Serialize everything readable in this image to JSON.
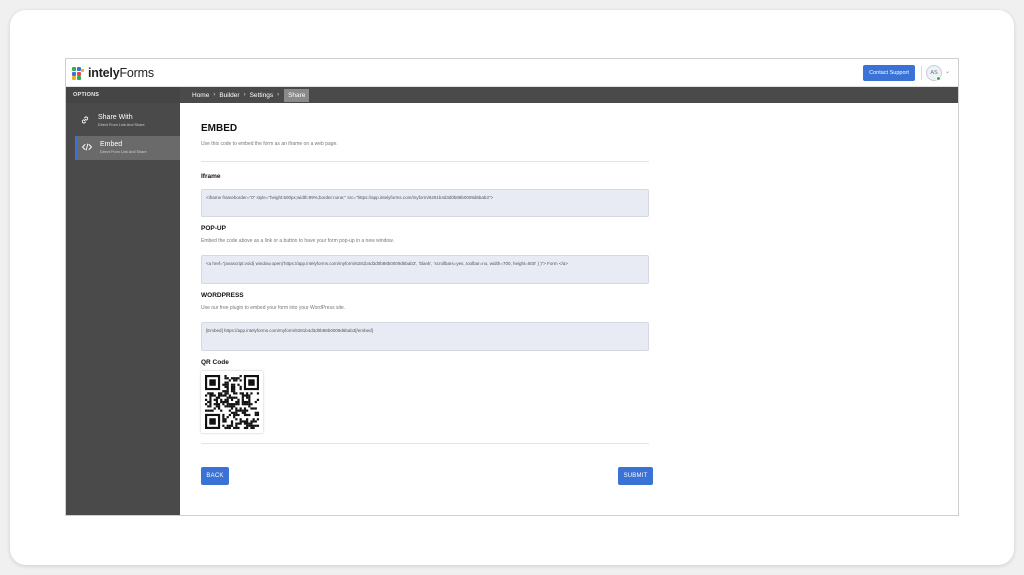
{
  "app": {
    "logo_bold": "intely",
    "logo_light": "Forms",
    "contact_label": "Contact Support",
    "avatar_initials": "AS",
    "colors": {
      "accent": "#3a73d5",
      "sidebar": "#4a4a4a",
      "online": "#2fb344"
    }
  },
  "sidebar": {
    "heading": "OPTIONS",
    "items": [
      {
        "title": "Share With",
        "subtitle": "Direct From Link And Share",
        "icon": "link-icon"
      },
      {
        "title": "Embed",
        "subtitle": "Direct From Link And Share",
        "icon": "code-icon"
      }
    ]
  },
  "breadcrumb": [
    "Home",
    "Builder",
    "Settings",
    "Share"
  ],
  "main": {
    "title": "EMBED",
    "description": "Use this code to embed the form as an iframe on a web page.",
    "iframe": {
      "label": "Iframe",
      "code": "<iframe frameborder=\"0\" style=\"height:500px;width:99%;border:none;\" src=\"https://app.intelyforms.com/myform/6281b4d3d0b88b0009d6bab3\">"
    },
    "popup": {
      "label": "POP-UP",
      "description": "Embed the code above as a link or a button to have your form pop-up in a new window.",
      "code": "<a href=\"javascript:void( window.open('https://app.intelyforms.com/myform/6281b4d3d0b88b0009d6bab3', 'blank', 'scrollbars=yes, toolbar=no, width=700, height=500' ) )\"> Form </a>"
    },
    "wordpress": {
      "label": "WORDPRESS",
      "description": "Use our free plugin to embed your form into your WordPress site.",
      "code": "[Embed] https://app.intelyforms.com/myform/6281b4d3d0b88b0009d6bab3[/embed]"
    },
    "qr": {
      "label": "QR Code"
    }
  },
  "actions": {
    "back": "BACK",
    "submit": "SUBMIT"
  }
}
